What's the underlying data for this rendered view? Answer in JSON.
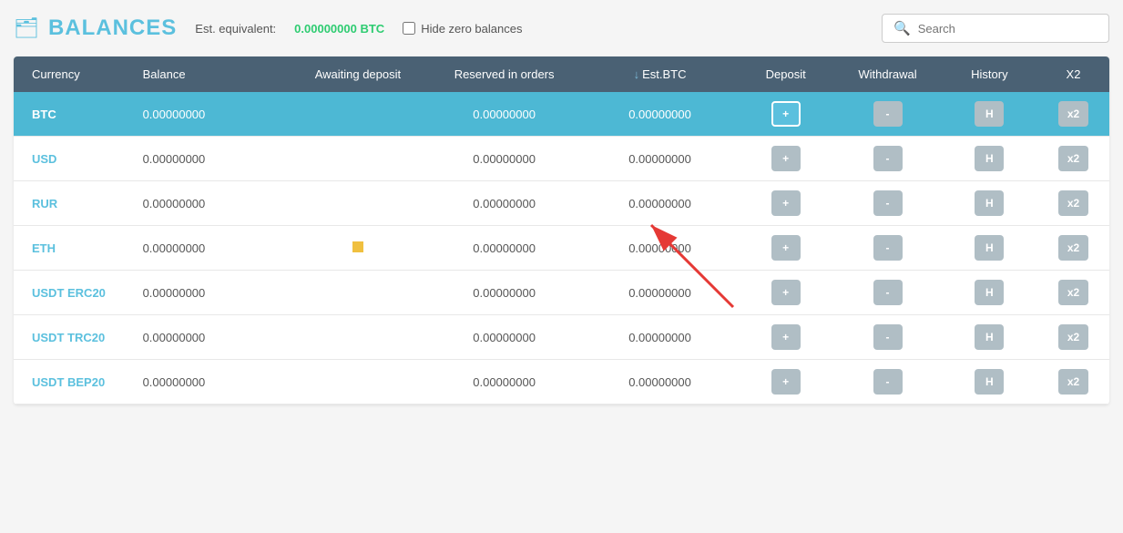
{
  "header": {
    "title": "BALANCES",
    "est_label": "Est. equivalent:",
    "est_value": "0.00000000 BTC",
    "hide_zero_label": "Hide zero balances",
    "search_placeholder": "Search"
  },
  "table": {
    "columns": [
      {
        "key": "currency",
        "label": "Currency"
      },
      {
        "key": "balance",
        "label": "Balance"
      },
      {
        "key": "awaiting",
        "label": "Awaiting deposit"
      },
      {
        "key": "reserved",
        "label": "Reserved in orders"
      },
      {
        "key": "estbtc",
        "label": "Est.BTC"
      },
      {
        "key": "deposit",
        "label": "Deposit"
      },
      {
        "key": "withdrawal",
        "label": "Withdrawal"
      },
      {
        "key": "history",
        "label": "History"
      },
      {
        "key": "x2",
        "label": "X2"
      }
    ],
    "rows": [
      {
        "currency": "BTC",
        "balance": "0.00000000",
        "awaiting": "",
        "reserved": "0.00000000",
        "estbtc": "0.00000000",
        "highlighted": true
      },
      {
        "currency": "USD",
        "balance": "0.00000000",
        "awaiting": "",
        "reserved": "0.00000000",
        "estbtc": "0.00000000"
      },
      {
        "currency": "RUR",
        "balance": "0.00000000",
        "awaiting": "",
        "reserved": "0.00000000",
        "estbtc": "0.00000000"
      },
      {
        "currency": "ETH",
        "balance": "0.00000000",
        "awaiting": "",
        "reserved": "0.00000000",
        "estbtc": "0.00000000",
        "eth_dot": true
      },
      {
        "currency": "USDT\nERC20",
        "balance": "0.00000000",
        "awaiting": "",
        "reserved": "0.00000000",
        "estbtc": "0.00000000"
      },
      {
        "currency": "USDT\nTRC20",
        "balance": "0.00000000",
        "awaiting": "",
        "reserved": "0.00000000",
        "estbtc": "0.00000000"
      },
      {
        "currency": "USDT\nBEP20",
        "balance": "0.00000000",
        "awaiting": "",
        "reserved": "0.00000000",
        "estbtc": "0.00000000"
      }
    ],
    "btn_labels": {
      "deposit": "+",
      "withdrawal": "-",
      "history": "H",
      "x2": "x2"
    }
  }
}
